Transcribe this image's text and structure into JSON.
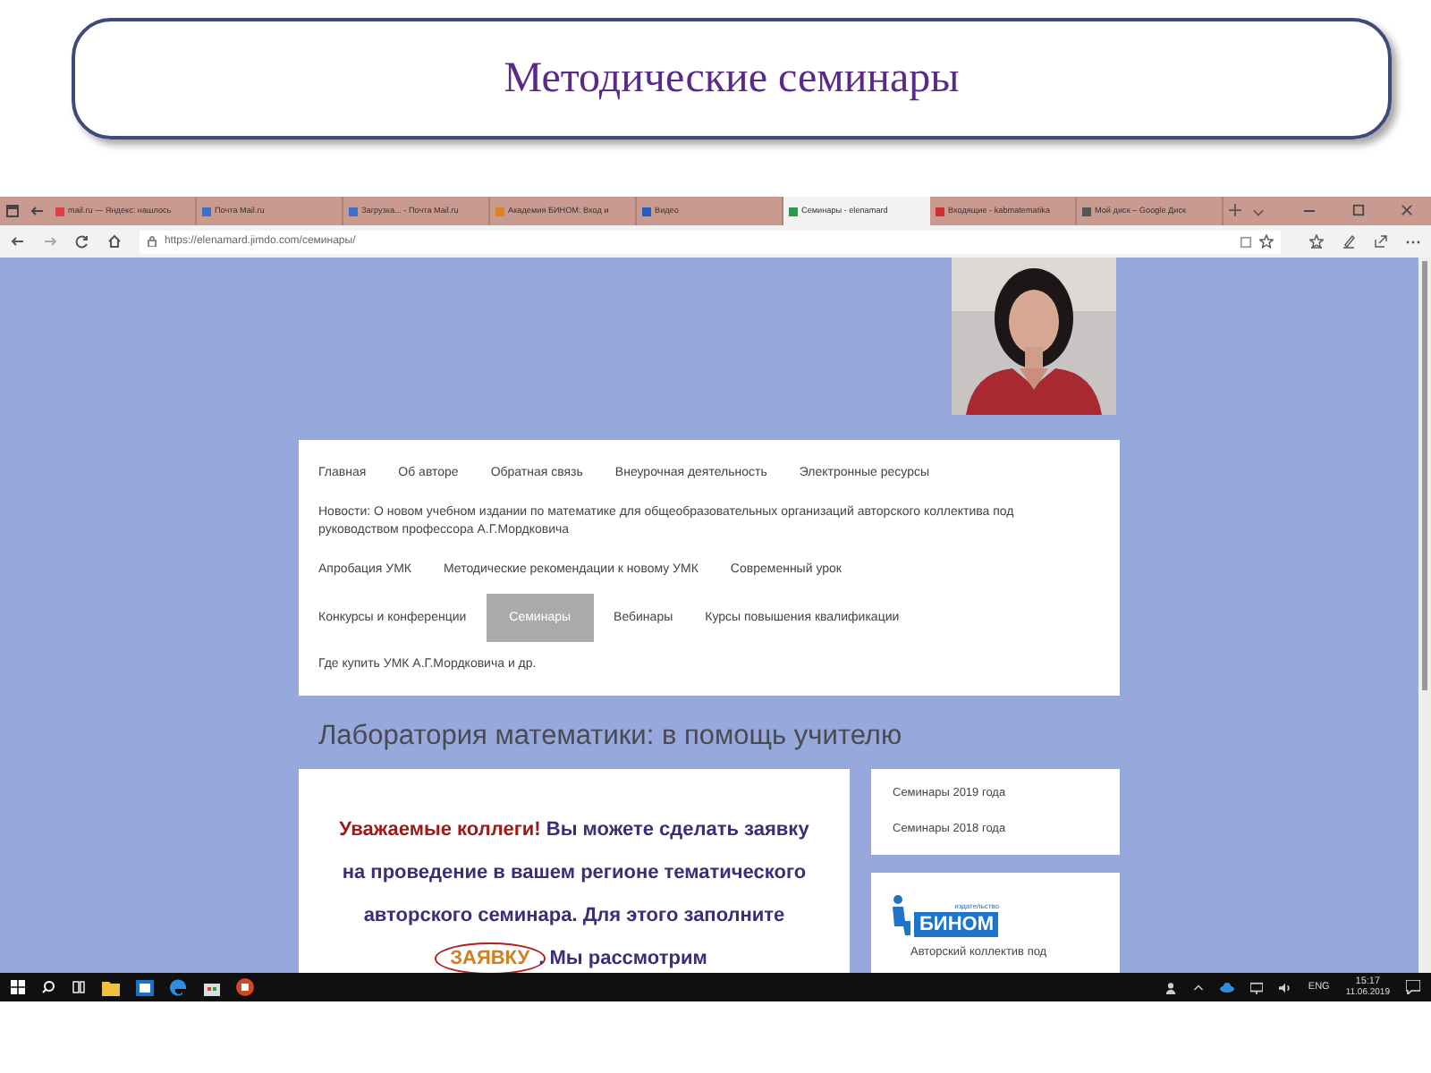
{
  "slide_title": "Методические семинары",
  "browser": {
    "tabs": [
      {
        "label": "mail.ru — Яндекс: нашлось",
        "color": "#e04040",
        "selected": false
      },
      {
        "label": "Почта Mail.ru",
        "color": "#3b6fd0",
        "selected": false
      },
      {
        "label": "Загрузка... - Почта Mail.ru",
        "color": "#3b6fd0",
        "selected": false
      },
      {
        "label": "Академия БИНОМ: Вход и",
        "color": "#e08020",
        "selected": false
      },
      {
        "label": "Видео",
        "color": "#2060c0",
        "selected": false
      },
      {
        "label": "Семинары - elenamard",
        "color": "#2a9a50",
        "selected": true
      },
      {
        "label": "Входящие - kabmatematika",
        "color": "#d03030",
        "selected": false
      },
      {
        "label": "Мой диск – Google Диск",
        "color": "#555555",
        "selected": false
      }
    ],
    "url": "https://elenamard.jimdo.com/семинары/"
  },
  "page": {
    "nav_rows": [
      [
        {
          "label": "Главная",
          "selected": false
        },
        {
          "label": "Об авторе",
          "selected": false
        },
        {
          "label": "Обратная связь",
          "selected": false
        },
        {
          "label": "Внеурочная деятельность",
          "selected": false
        },
        {
          "label": "Электронные ресурсы",
          "selected": false
        }
      ],
      [
        {
          "label": "Новости: О новом учебном издании по математике для общеобразовательных организаций авторского коллектива под руководством профессора А.Г.Мордковича",
          "selected": false
        }
      ],
      [
        {
          "label": "Апробация УМК",
          "selected": false
        },
        {
          "label": "Методические рекомендации к новому УМК",
          "selected": false
        },
        {
          "label": "Современный урок",
          "selected": false
        }
      ],
      [
        {
          "label": "Конкурсы и конференции",
          "selected": false
        },
        {
          "label": "Семинары",
          "selected": true
        },
        {
          "label": "Вебинары",
          "selected": false
        },
        {
          "label": "Курсы повышения квалификации",
          "selected": false
        }
      ],
      [
        {
          "label": "Где купить УМК А.Г.Мордковича и др.",
          "selected": false
        }
      ]
    ],
    "heading": "Лаборатория математики: в помощь учителю",
    "notice": [
      {
        "kind": "greeting",
        "text": "Уважаемые коллеги!"
      },
      {
        "kind": "body",
        "text": " Вы можете сделать заявку на проведение в вашем регионе тематического авторского семинара. Для этого заполните "
      },
      {
        "kind": "link",
        "text": "ЗАЯВКУ"
      },
      {
        "kind": "body",
        "text": ". Мы рассмотрим"
      }
    ],
    "side_links": [
      "Семинары 2019 года",
      "Семинары 2018 года"
    ],
    "logo": {
      "caption": "издательство",
      "name": "БИНОМ"
    },
    "side_text": "Авторский коллектив под"
  },
  "taskbar": {
    "language": "ENG",
    "time": "15:17",
    "date": "11.06.2019"
  }
}
